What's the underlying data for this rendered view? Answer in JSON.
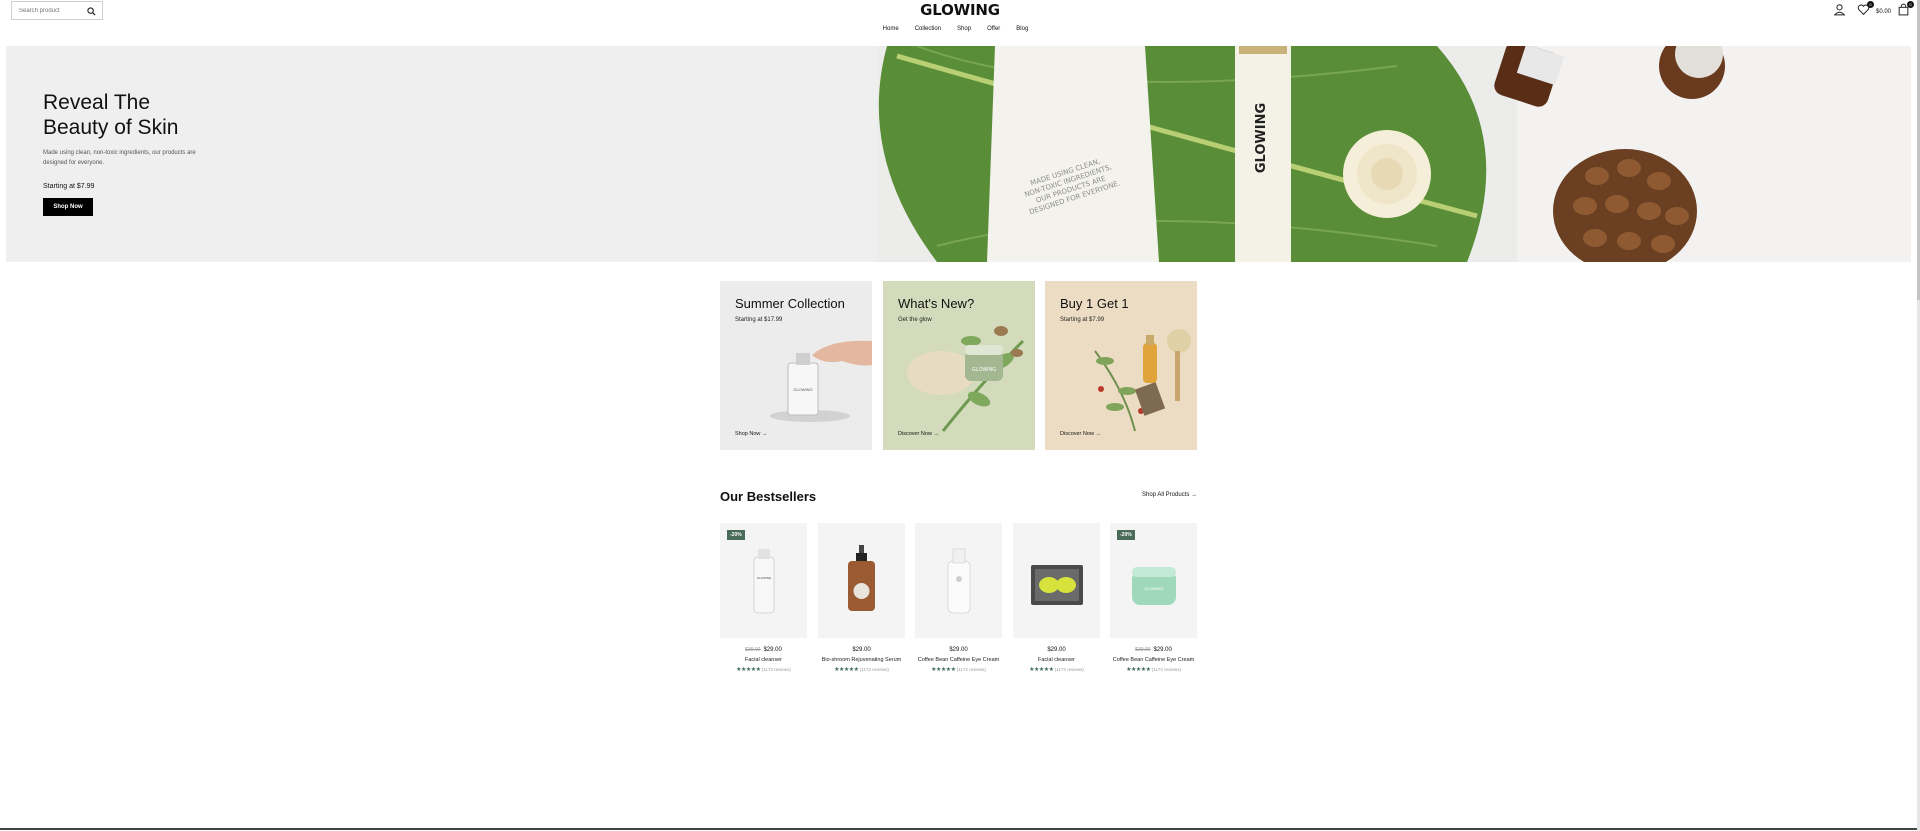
{
  "header": {
    "search_placeholder": "Search product",
    "logo": "GLOWING",
    "nav": [
      "Home",
      "Collection",
      "Shop",
      "Offer",
      "Blog"
    ],
    "wishlist_count": "0",
    "cart_count": "0",
    "cart_total": "$0.00"
  },
  "hero": {
    "title_line1": "Reveal The",
    "title_line2": "Beauty of Skin",
    "description": "Made using clean, non-toxic ingredients, our products are designed for everyone.",
    "price": "Starting at $7.99",
    "button": "Shop Now",
    "tube_text": "MADE USING CLEAN, NON-TOXIC INGREDIENTS, OUR PRODUCTS ARE DESIGNED FOR EVERYONE.",
    "bottle_text": "GLOWING"
  },
  "promos": [
    {
      "title": "Summer Collection",
      "subtitle": "Starting at $17.99",
      "link": "Shop Now",
      "bg": "#ececec"
    },
    {
      "title": "What's New?",
      "subtitle": "Get the glow",
      "link": "Discover Now",
      "bg": "#d3dbbc"
    },
    {
      "title": "Buy 1 Get 1",
      "subtitle": "Starting at $7.99",
      "link": "Discover Now",
      "bg": "#ecdcc4"
    }
  ],
  "bestsellers": {
    "title": "Our Bestsellers",
    "shop_all": "Shop All Products",
    "products": [
      {
        "badge": "-20%",
        "old_price": "$39.00",
        "price": "$29.00",
        "name": "Facial cleanser",
        "reviews": "(1172 reviews)",
        "rating": 5
      },
      {
        "badge": "",
        "old_price": "",
        "price": "$29.00",
        "name": "Bio-shroom Rejuvenating Serum",
        "reviews": "(1172 reviews)",
        "rating": 5
      },
      {
        "badge": "",
        "old_price": "",
        "price": "$29.00",
        "name": "Coffee Bean Caffeine Eye Cream",
        "reviews": "(1172 reviews)",
        "rating": 5
      },
      {
        "badge": "",
        "old_price": "",
        "price": "$29.00",
        "name": "Facial cleanser",
        "reviews": "(1172 reviews)",
        "rating": 5
      },
      {
        "badge": "-20%",
        "old_price": "$39.00",
        "price": "$29.00",
        "name": "Coffee Bean Caffeine Eye Cream",
        "reviews": "(1172 reviews)",
        "rating": 5
      }
    ]
  },
  "colors": {
    "accent": "#3f6b58",
    "badge": "#4a6b57",
    "hero_bg": "#efefef",
    "leaf": "#5c8f3a"
  },
  "icons": [
    "search-icon",
    "user-icon",
    "heart-icon",
    "bag-icon",
    "arrow-right-icon",
    "star-icon"
  ]
}
